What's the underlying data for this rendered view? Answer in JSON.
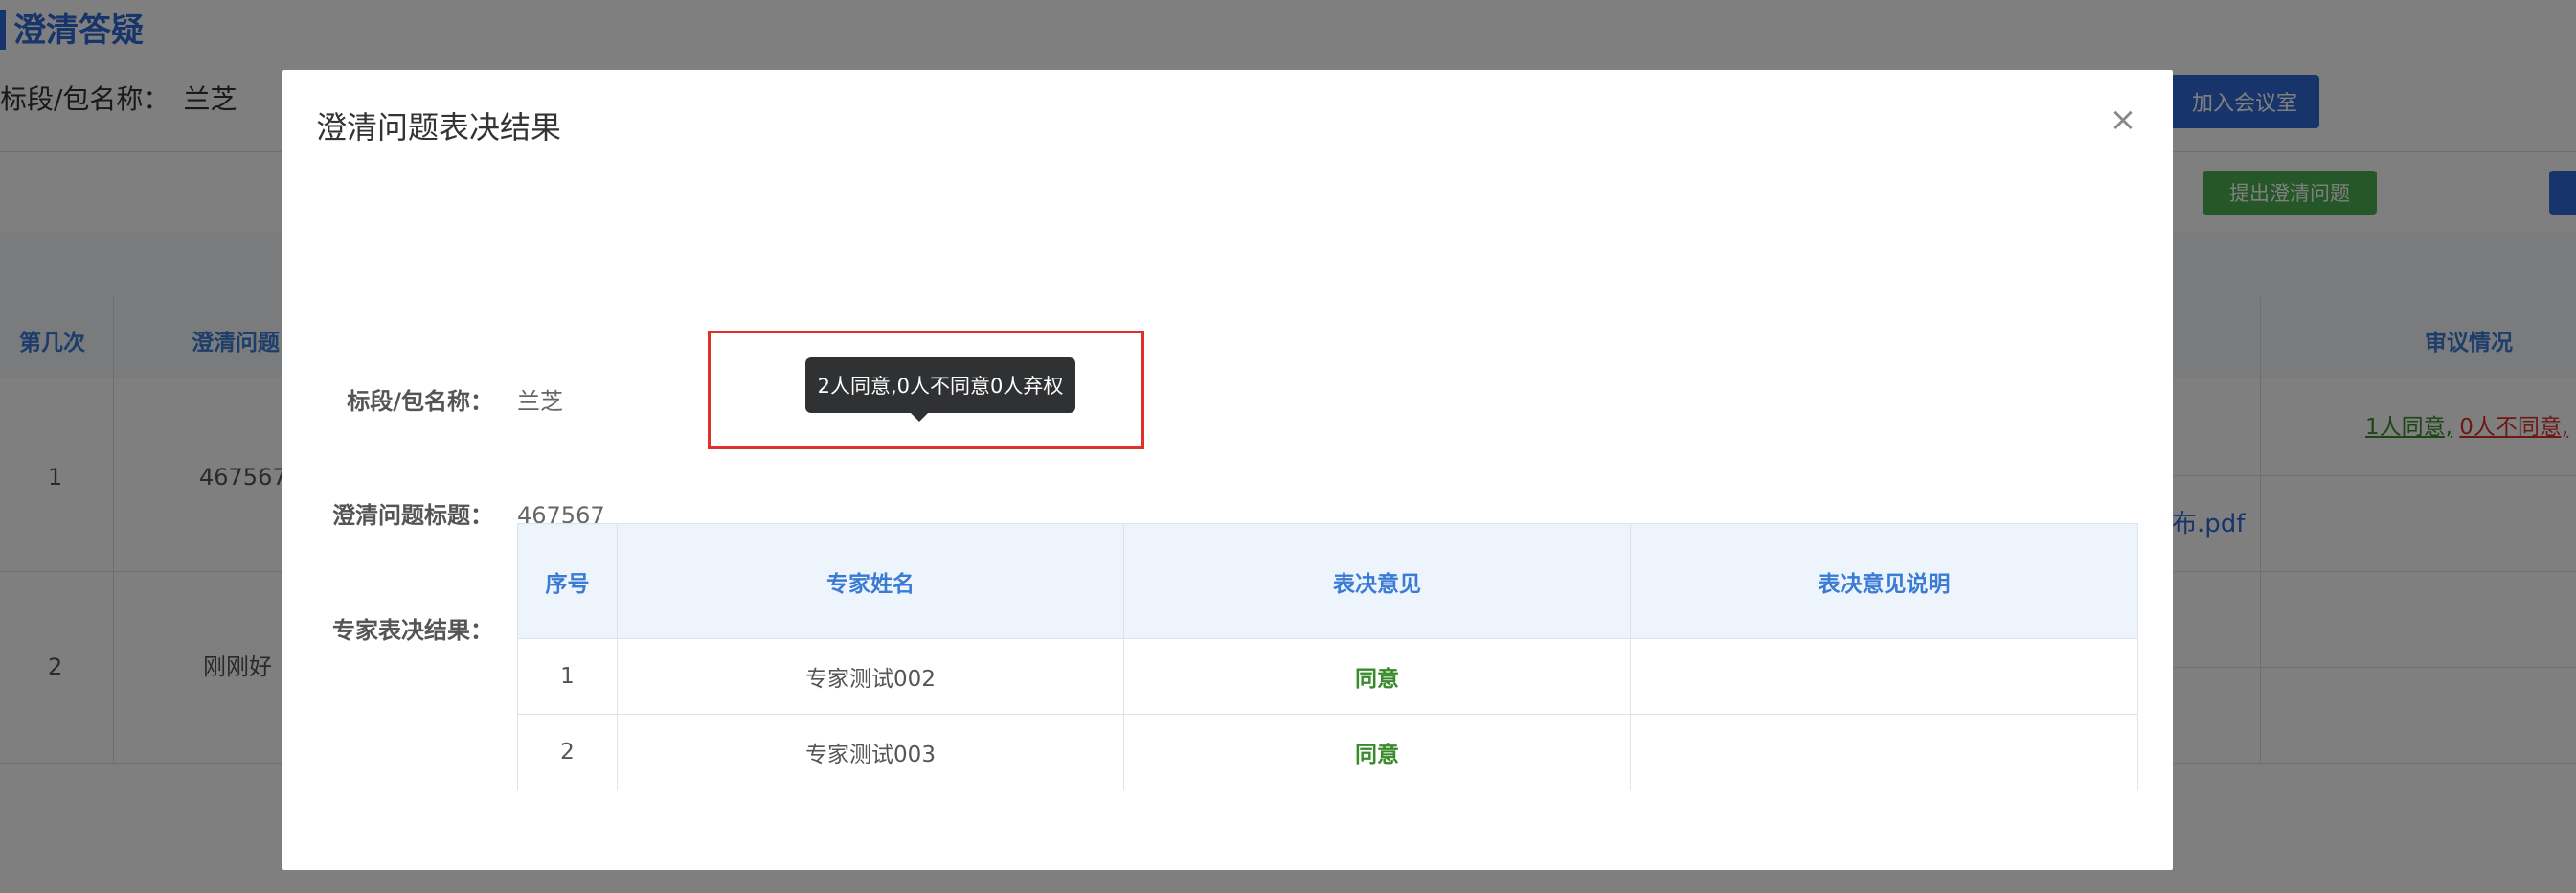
{
  "page": {
    "title": "澄清答疑",
    "package_label": "标段/包名称：",
    "package_name": "兰芝",
    "join_room_label": "加入会议室",
    "raise_question_label": "提出澄清问题",
    "table_headers": {
      "round": "第几次",
      "question": "澄清问题",
      "review": "审议情况"
    },
    "rows": [
      {
        "round": "1",
        "question": "467567",
        "file_link": "布.pdf"
      },
      {
        "round": "2",
        "question": "刚刚好"
      }
    ],
    "review_status": {
      "agree": "1人同意,",
      "disagree": "0人不同意,"
    }
  },
  "modal": {
    "title": "澄清问题表决结果",
    "close_symbol": "×",
    "package_label": "标段/包名称：",
    "package_value": "兰芝",
    "question_title_label": "澄清问题标题：",
    "question_title_value": "467567",
    "result_label": "专家表决结果：",
    "tooltip": "2人同意,0人不同意0人弃权",
    "table": {
      "headers": [
        "序号",
        "专家姓名",
        "表决意见",
        "表决意见说明"
      ],
      "rows": [
        {
          "no": "1",
          "name": "专家测试002",
          "opinion": "同意",
          "note": ""
        },
        {
          "no": "2",
          "name": "专家测试003",
          "opinion": "同意",
          "note": ""
        }
      ]
    }
  },
  "colors": {
    "primary": "#2f6bd4",
    "success": "#4caf50",
    "agree_text": "#3a8a2c",
    "disagree_text": "#d9312b",
    "highlight": "#e0302a"
  }
}
